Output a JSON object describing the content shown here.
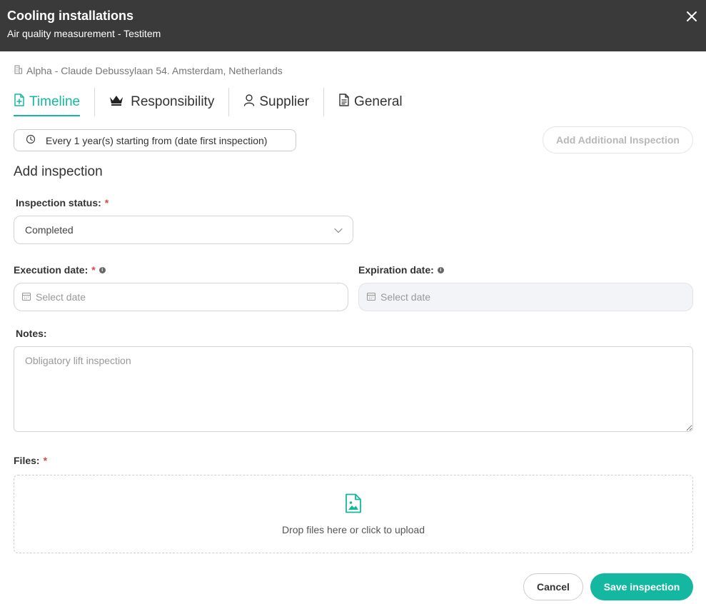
{
  "header": {
    "title": "Cooling installations",
    "subtitle": "Air quality measurement - Testitem"
  },
  "address": "Alpha - Claude Debussylaan 54. Amsterdam, Netherlands",
  "tabs": [
    {
      "label": "Timeline",
      "active": true,
      "icon": "file-plus-icon"
    },
    {
      "label": "Responsibility",
      "active": false,
      "icon": "crown-icon"
    },
    {
      "label": "Supplier",
      "active": false,
      "icon": "user-icon"
    },
    {
      "label": "General",
      "active": false,
      "icon": "document-icon"
    }
  ],
  "frequency": "Every 1 year(s) starting from (date first inspection)",
  "add_additional_label": "Add Additional Inspection",
  "section_title": "Add inspection",
  "form": {
    "status_label": "Inspection status:",
    "status_value": "Completed",
    "execution_label": "Execution date:",
    "execution_placeholder": "Select date",
    "expiration_label": "Expiration date:",
    "expiration_placeholder": "Select date",
    "notes_label": "Notes:",
    "notes_placeholder": "Obligatory lift inspection",
    "files_label": "Files:",
    "dropzone_text": "Drop files here or click to upload",
    "required_mark": "*",
    "info_mark": "i"
  },
  "buttons": {
    "cancel": "Cancel",
    "save": "Save inspection"
  },
  "colors": {
    "accent": "#14b8a0",
    "header_bg": "#3a3a3a",
    "required": "#e04545"
  }
}
